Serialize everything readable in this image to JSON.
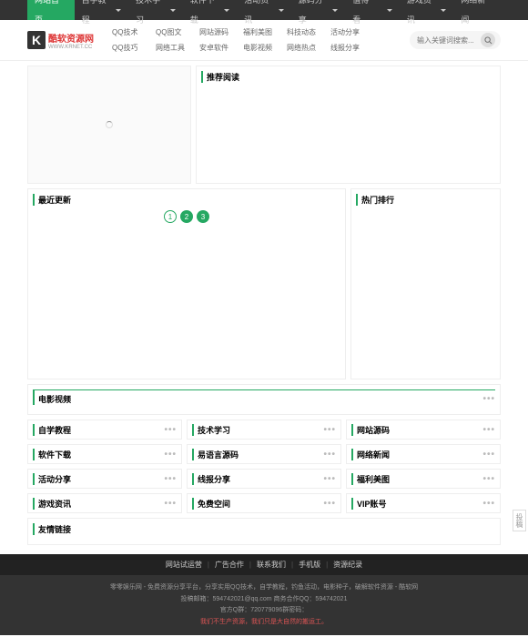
{
  "topnav": [
    {
      "label": "网站首页",
      "active": true,
      "dd": false
    },
    {
      "label": "自学教程",
      "dd": true
    },
    {
      "label": "技术学习",
      "dd": true
    },
    {
      "label": "软件下载",
      "dd": true
    },
    {
      "label": "活动资讯",
      "dd": true
    },
    {
      "label": "源码分享",
      "dd": true
    },
    {
      "label": "值得一看",
      "dd": true
    },
    {
      "label": "游戏资讯",
      "dd": true
    },
    {
      "label": "网络新闻",
      "dd": false
    }
  ],
  "logo": {
    "cn": "酷软资源网",
    "en": "WWW.KRNET.CC"
  },
  "header_links": [
    "QQ技术",
    "QQ图文",
    "网站源码",
    "福利美图",
    "科技动态",
    "活动分享",
    "QQ技巧",
    "网络工具",
    "安卓软件",
    "电影视频",
    "网络热点",
    "线报分享"
  ],
  "search": {
    "placeholder": "输入关键词搜索..."
  },
  "sections": {
    "recommend": "推荐阅读",
    "recent": "最近更新",
    "hot": "热门排行",
    "movie": "电影视频",
    "friend": "友情链接"
  },
  "pager": [
    "1",
    "2",
    "3"
  ],
  "grid": [
    [
      "自学教程",
      "技术学习",
      "网站源码"
    ],
    [
      "软件下载",
      "易语言源码",
      "网络新闻"
    ],
    [
      "活动分享",
      "线报分享",
      "福利美图"
    ],
    [
      "游戏资讯",
      "免费空间",
      "VIP账号"
    ]
  ],
  "feedback": "投稿",
  "footer_nav": [
    "网站试运营",
    "广告合作",
    "联系我们",
    "手机版",
    "资源纪录"
  ],
  "footer": {
    "l1": "零零娱乐网 - 免费资源分享平台，分享实用QQ技术，自学教程，钓鱼活动，电影种子，破解软件资源 - 酷软网",
    "l2_a": "投稿邮箱：",
    "l2_b": "594742021@qq.com 商务合作QQ：594742021",
    "l3": "官方Q群：720779096群密码：",
    "l4": "我们不生产资源，我们只是大自然的搬运工。"
  }
}
